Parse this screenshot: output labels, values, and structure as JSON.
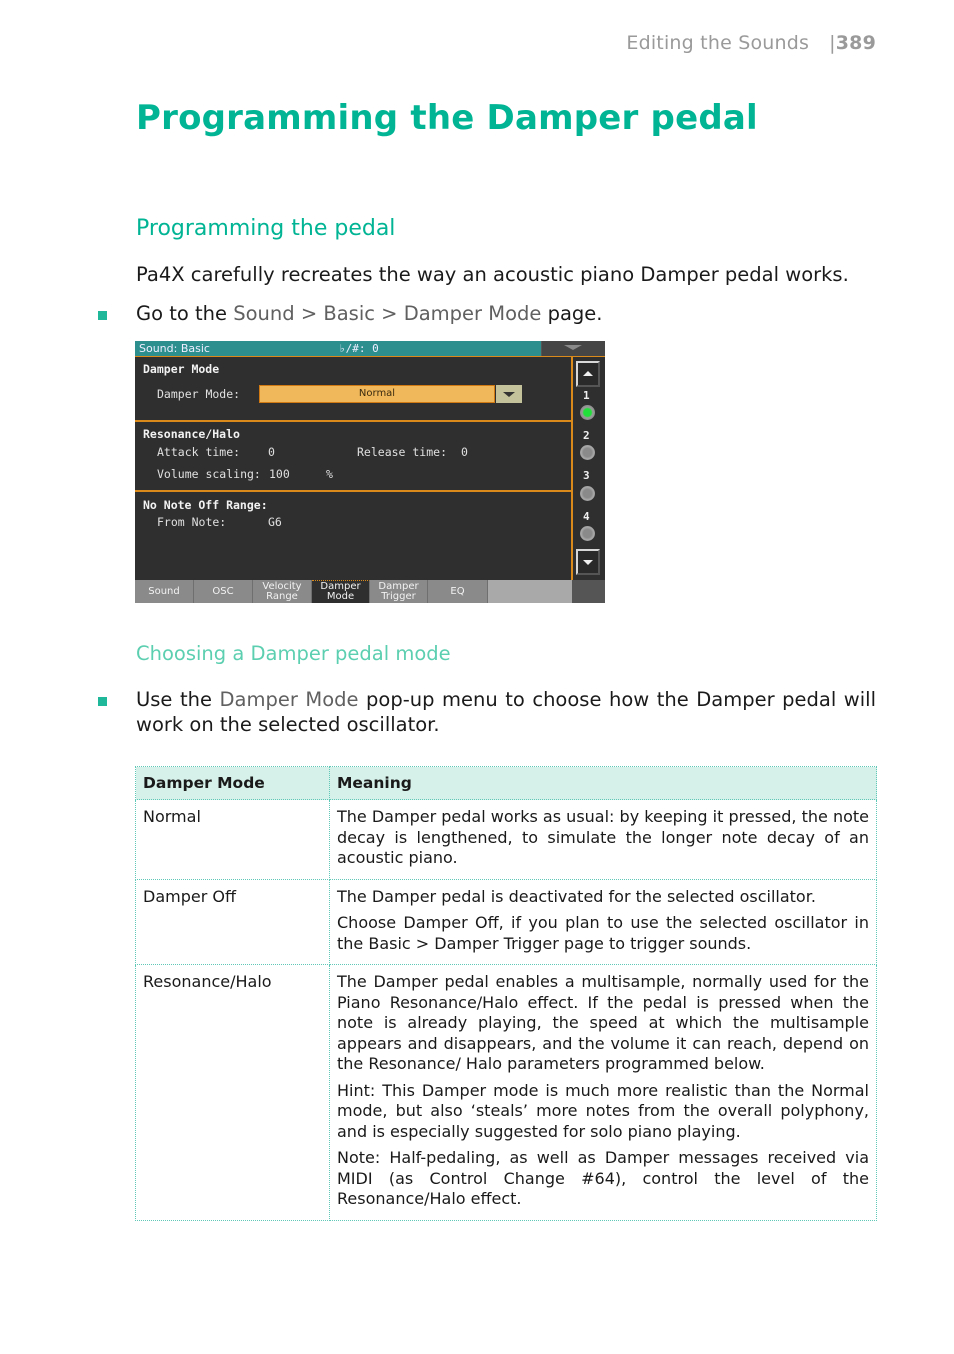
{
  "header": {
    "section": "Editing the Sounds",
    "page_number": "389"
  },
  "title": "Programming the Damper pedal",
  "section_heading": "Programming the pedal",
  "intro": "Pa4X carefully recreates the way an acoustic piano Damper pedal works.",
  "step1": {
    "prefix": "Go to the ",
    "path": "Sound > Basic > Damper Mode",
    "suffix": " page."
  },
  "screen": {
    "top_title": "Sound: Basic",
    "transpose": "♭/#: 0",
    "damper_section": "Damper Mode",
    "damper_label": "Damper Mode:",
    "damper_value": "Normal",
    "resonance_section": "Resonance/Halo",
    "attack_label": "Attack time:",
    "attack_value": "0",
    "release_label": "Release time:",
    "release_value": "0",
    "volume_label": "Volume scaling:",
    "volume_value": "100",
    "volume_unit": "%",
    "nonoteoff_section": "No Note Off Range:",
    "from_note_label": "From Note:",
    "from_note_value": "G6",
    "oscillators": [
      {
        "num": "1",
        "active": true
      },
      {
        "num": "2",
        "active": false
      },
      {
        "num": "3",
        "active": false
      },
      {
        "num": "4",
        "active": false
      }
    ],
    "tabs": [
      {
        "label": "Sound",
        "active": false
      },
      {
        "label": "OSC",
        "active": false
      },
      {
        "label": "Velocity Range",
        "active": false
      },
      {
        "label": "Damper Mode",
        "active": true
      },
      {
        "label": "Damper Trigger",
        "active": false
      },
      {
        "label": "EQ",
        "active": false
      }
    ]
  },
  "subsection_heading": "Choosing a Damper pedal mode",
  "step2": {
    "prefix": "Use the ",
    "term": "Damper Mode",
    "suffix": " pop-up menu to choose how the Damper pedal will work on the selected oscillator."
  },
  "table": {
    "headers": [
      "Damper Mode",
      "Meaning"
    ],
    "rows": [
      {
        "mode": "Normal",
        "meaning": [
          "The Damper pedal works as usual: by keeping it pressed, the note decay is lengthened, to simulate the longer note decay of an acoustic piano."
        ]
      },
      {
        "mode": "Damper Off",
        "meaning": [
          "The Damper pedal is deactivated for the selected oscillator.",
          "Choose Damper Off, if you plan to use the selected oscillator in the Basic > Damper Trigger page to trigger sounds."
        ]
      },
      {
        "mode": "Resonance/Halo",
        "meaning": [
          "The Damper pedal enables a multisample, normally used for the Piano Resonance/Halo effect. If the pedal is pressed when the note is already playing, the speed at which the multisample appears and disappears, and the volume it can reach, depend on the Resonance/ Halo parameters programmed below.",
          "Hint: This Damper mode is much more realistic than the Normal mode, but also ‘steals’ more notes from the overall polyphony, and is especially suggested for solo piano playing.",
          "Note: Half-pedaling, as well as Damper messages received via MIDI (as Control Change #64), control the level of the Resonance/Halo effect."
        ]
      }
    ]
  },
  "colors": {
    "accent": "#00b494",
    "subheading": "#5ccfb0",
    "table_header_bg": "#d6f1ea",
    "screen_bg": "#2f2f2f",
    "screen_accent": "#d98a1a"
  }
}
